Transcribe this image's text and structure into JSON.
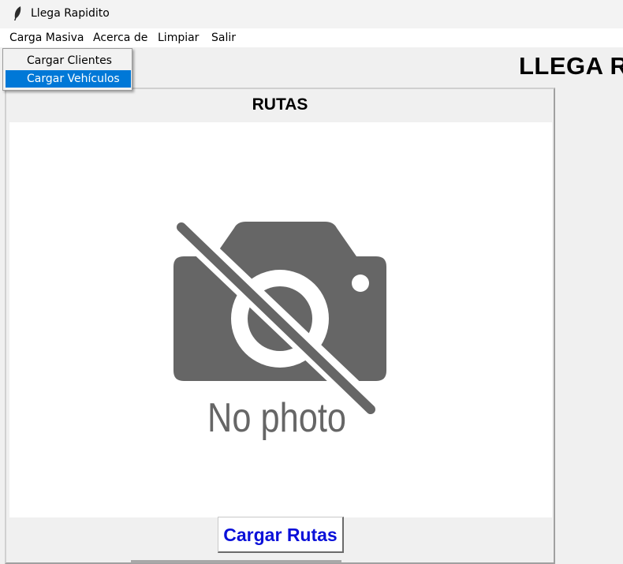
{
  "window": {
    "title": "Llega Rapidito",
    "icon": "feather-icon"
  },
  "menubar": {
    "items": [
      {
        "label": "Carga Masiva"
      },
      {
        "label": "Acerca de"
      },
      {
        "label": "Limpiar"
      },
      {
        "label": "Salir"
      }
    ]
  },
  "dropdown": {
    "items": [
      {
        "label": "Cargar Clientes",
        "selected": false
      },
      {
        "label": "Cargar Vehículos",
        "selected": true
      }
    ]
  },
  "banner": {
    "text": "LLEGA R"
  },
  "panel": {
    "heading": "RUTAS",
    "placeholder": {
      "text": "No photo",
      "icon": "no-photo-camera-icon"
    },
    "button_label": "Cargar Rutas"
  },
  "colors": {
    "selection": "#0078d7",
    "button_text": "#0a10d9",
    "placeholder_gray": "#666666"
  }
}
